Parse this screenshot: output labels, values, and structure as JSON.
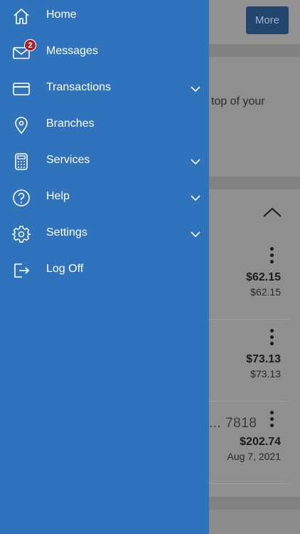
{
  "background": {
    "more_label": "More",
    "promo_text": "top of your",
    "rows": [
      {
        "amount": "$62.15",
        "sub": "$62.15"
      },
      {
        "amount": "$73.13",
        "sub": "$73.13"
      },
      {
        "account": "... 7818",
        "amount": "$202.74",
        "sub": "Aug 7, 2021"
      }
    ]
  },
  "menu": {
    "items": [
      {
        "label": "Home",
        "icon": "home-icon"
      },
      {
        "label": "Messages",
        "icon": "envelope-icon",
        "badge": "2"
      },
      {
        "label": "Transactions",
        "icon": "credit-card-icon",
        "expandable": true
      },
      {
        "label": "Branches",
        "icon": "map-pin-icon"
      },
      {
        "label": "Services",
        "icon": "calculator-icon",
        "expandable": true
      },
      {
        "label": "Help",
        "icon": "help-circle-icon",
        "expandable": true
      },
      {
        "label": "Settings",
        "icon": "gear-icon",
        "expandable": true
      },
      {
        "label": "Log Off",
        "icon": "log-off-icon"
      }
    ]
  },
  "colors": {
    "drawer": "#2e73bc",
    "badge": "#b51f24",
    "more_button": "#23466f"
  }
}
